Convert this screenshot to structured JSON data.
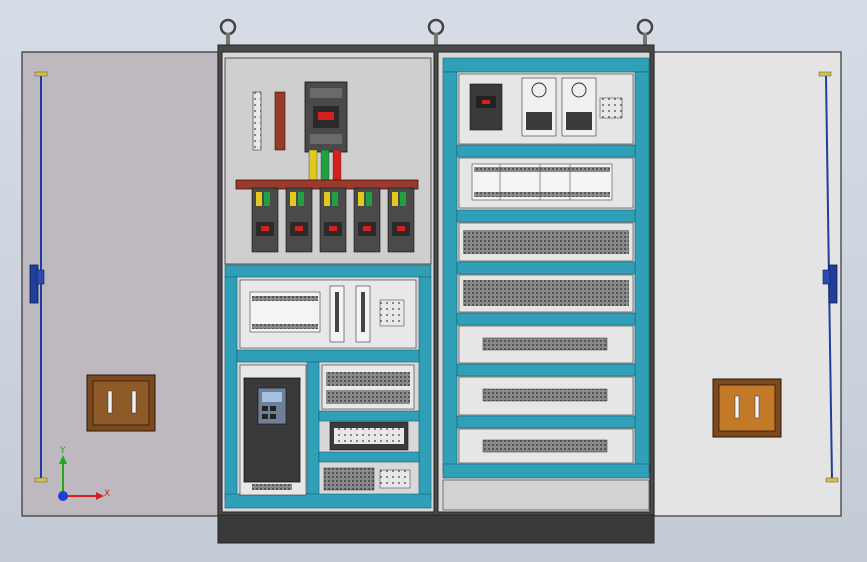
{
  "axes": {
    "x_label": "X",
    "y_label": "Y"
  },
  "colors": {
    "background": "#d4dae3",
    "door_left": "#bdb9bf",
    "door_right": "#e4e4e4",
    "cabinet_frame": "#3d3d3d",
    "mounting_plate": "#cfcfcf",
    "cable_duct": "#2fa0b8",
    "copper_busbar": "#9a3a2a",
    "plinth": "#3a3a3a",
    "door_rod": "#1f3f9a",
    "terminal_box": "#7a4a1e",
    "axis_x": "#d42020",
    "axis_y": "#1faa1f",
    "axis_z": "#1f3fd4"
  },
  "components": {
    "left_cabinet": [
      "main-breaker",
      "busbar",
      "branch-breakers",
      "plc-module",
      "vfd-inverter",
      "relay-bank",
      "terminal-block"
    ],
    "right_cabinet": [
      "contactor",
      "power-supplies",
      "plc-rack",
      "relay-rows",
      "terminal-strips"
    ]
  }
}
